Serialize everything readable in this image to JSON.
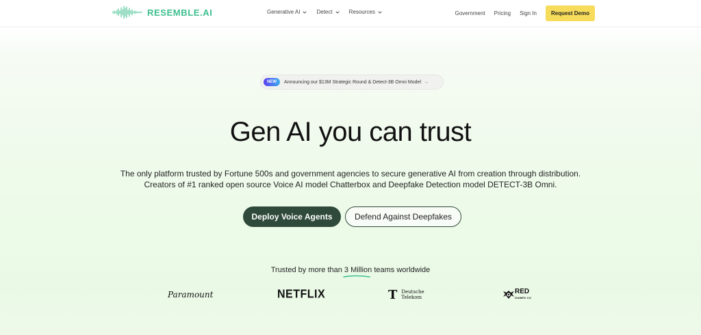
{
  "header": {
    "logo_text": "RESEMBLE.AI",
    "nav": [
      {
        "label": "Generative AI",
        "has_dropdown": true
      },
      {
        "label": "Detect",
        "has_dropdown": true
      },
      {
        "label": "Resources",
        "has_dropdown": true
      }
    ],
    "right_links": [
      "Government",
      "Pricing",
      "Sign In"
    ],
    "cta_label": "Request Demo"
  },
  "announcement": {
    "badge": "NEW",
    "text": "Announcing our $13M Strategic Round & Detect-3B Omni Model",
    "arrow": "→"
  },
  "hero": {
    "title": "Gen AI you can trust",
    "subtitle_line1": "The only platform trusted by Fortune 500s and government agencies to secure generative AI from creation through distribution.",
    "subtitle_line2": "Creators of #1 ranked open source Voice AI model Chatterbox and Deepfake Detection model DETECT-3B Omni.",
    "primary_cta": "Deploy Voice Agents",
    "secondary_cta": "Defend Against Deepfakes"
  },
  "trusted": {
    "prefix": "Trusted by more than",
    "highlight": "3 Million",
    "suffix": "teams worldwide"
  },
  "logos": {
    "paramount": "Paramount",
    "netflix": "NETFLIX",
    "telekom_line1": "Deutsche",
    "telekom_line2": "Telekom",
    "telekom_mark": "T",
    "red_text": "RED",
    "red_sub": "GAMES CO"
  },
  "colors": {
    "brand_green": "#3cbf8e",
    "primary_button": "#2f4a3a",
    "demo_button": "#f6dc5a"
  }
}
